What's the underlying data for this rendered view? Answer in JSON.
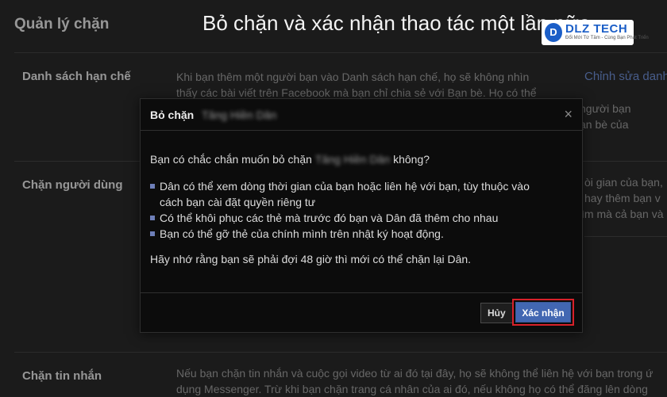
{
  "banner": {
    "text": "Bỏ chặn và xác nhận thao tác một lần nữa"
  },
  "logo": {
    "mark": "D",
    "name": "DLZ TECH",
    "tagline": "Đổi Mới Từ Tâm - Cùng Bạn Phát Triển"
  },
  "page": {
    "title": "Quản lý chặn",
    "sections": [
      {
        "label": "Danh sách hạn chế",
        "lines": [
          "Khi bạn thêm một người bạn vào Danh sách hạn chế, họ sẽ không nhìn",
          "thấy các bài viết trên Facebook mà bạn chỉ chia sẻ với Bạn bè. Họ có thể"
        ],
        "right_lines": [
          "người bạn",
          "ạn bè của"
        ],
        "edit_link": "Chỉnh sửa danh"
      },
      {
        "label": "Chặn người dùng",
        "right_lines": [
          "òi gian của bạn,",
          "hay thêm bạn v",
          "ìm mà cả bạn và r"
        ]
      },
      {
        "label": "Chặn tin nhắn",
        "lines": [
          "Nếu bạn chặn tin nhắn và cuộc gọi video từ ai đó tại đây, họ sẽ không thể liên hệ với bạn trong ứ",
          "dụng Messenger. Trừ khi bạn chặn trang cá nhân của ai đó, nếu không họ có thể đăng lên dòng"
        ]
      }
    ]
  },
  "dialog": {
    "title": "Bỏ chặn",
    "blurred_name": "Tăng Hiền Dân",
    "question_prefix": "Bạn có chắc chắn muốn bỏ chặn",
    "question_suffix": "không?",
    "points": [
      "Dân có thể xem dòng thời gian của bạn hoặc liên hệ với bạn, tùy thuộc vào",
      "cách bạn cài đặt quyền riêng tư",
      "Có thể khôi phục các thẻ mà trước đó bạn và Dân đã thêm cho nhau",
      "Bạn có thể gỡ thẻ của chính mình trên nhật ký hoạt động."
    ],
    "note": "Hãy nhớ rằng bạn sẽ phải đợi 48 giờ thì mới có thể chặn lại Dân.",
    "close_glyph": "×",
    "cancel_label": "Hủy",
    "confirm_label": "Xác nhận"
  },
  "colors": {
    "accent": "#4267b2",
    "highlight": "#d8212a",
    "link": "#6f8fd6"
  },
  "icons": [
    "close-icon"
  ]
}
